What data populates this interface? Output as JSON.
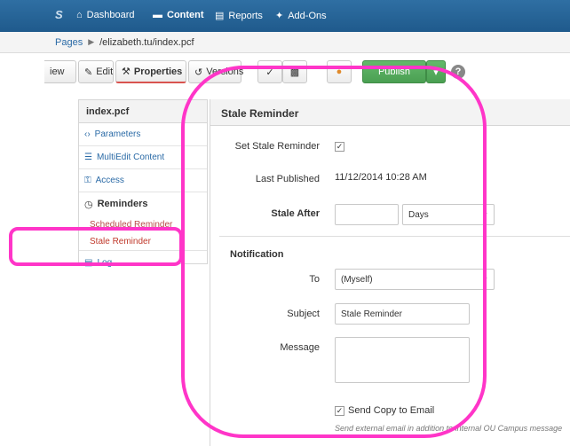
{
  "topnav": {
    "logo": "S",
    "items": [
      {
        "label": "Dashboard",
        "icon": "home-icon"
      },
      {
        "label": "Content",
        "icon": "folder-icon"
      },
      {
        "label": "Reports",
        "icon": "reports-icon"
      },
      {
        "label": "Add-Ons",
        "icon": "plugin-icon"
      }
    ],
    "bg_color": "#2a6aa6"
  },
  "breadcrumb": {
    "root": "Pages",
    "current": "/elizabeth.tu/index.pcf"
  },
  "toolbar": {
    "view": "iew",
    "edit": "Edit",
    "properties": "Properties",
    "versions": "Versions",
    "publish": "Publish"
  },
  "sidebar": {
    "title": "index.pcf",
    "items": [
      {
        "label": "Parameters",
        "icon": "code-icon"
      },
      {
        "label": "MultiEdit Content",
        "icon": "list-icon"
      },
      {
        "label": "Access",
        "icon": "key-icon"
      },
      {
        "label": "Reminders",
        "icon": "clock-icon"
      }
    ],
    "sub_items": [
      "Scheduled Reminder",
      "Stale Reminder"
    ],
    "log": "Log"
  },
  "panel": {
    "title": "Stale Reminder",
    "set_stale_label": "Set Stale Reminder",
    "set_stale_checked": true,
    "last_published_label": "Last Published",
    "last_published_value": "11/12/2014 10:28 AM",
    "stale_after_label": "Stale After",
    "stale_after_value": "",
    "stale_after_unit": "Days",
    "notification_title": "Notification",
    "to_label": "To",
    "to_value": "(Myself)",
    "subject_label": "Subject",
    "subject_value": "Stale Reminder",
    "message_label": "Message",
    "message_value": "",
    "send_copy_label": "Send Copy to Email",
    "send_copy_checked": true,
    "send_copy_note": "Send external email in addition to internal OU Campus message"
  },
  "annotation_color": "#ff35c8"
}
